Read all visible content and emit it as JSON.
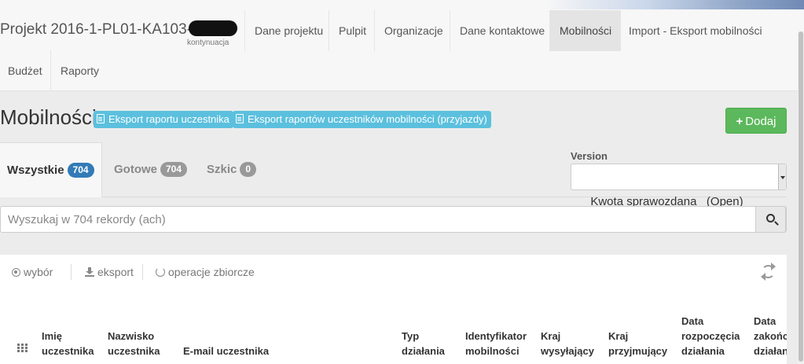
{
  "header": {
    "brand": "Projekt 2016-1-PL01-KA103-",
    "brand_sub": "kontynuacja",
    "nav": [
      {
        "label": "Dane projektu"
      },
      {
        "label": "Pulpit"
      },
      {
        "label": "Organizacje"
      },
      {
        "label": "Dane kontaktowe"
      },
      {
        "label": "Mobilności",
        "active": true
      },
      {
        "label": "Import - Eksport mobilności"
      },
      {
        "label": "Budżet"
      },
      {
        "label": "Raporty"
      }
    ]
  },
  "page": {
    "title": "Mobilności",
    "export_participant_report": "Eksport raportu uczestnika",
    "export_mobility_reports": "Eksport raportów uczestników mobilności (przyjazdy)",
    "add_button": "Dodaj"
  },
  "tabs": [
    {
      "label": "Wszystkie",
      "count": "704",
      "active": true
    },
    {
      "label": "Gotowe",
      "count": "704"
    },
    {
      "label": "Szkic",
      "count": "0"
    }
  ],
  "version": {
    "label": "Version",
    "selected": "Kwota sprawozdana   (Open)"
  },
  "search": {
    "placeholder": "Wyszukaj w 704 rekordy (ach)"
  },
  "toolbar": {
    "select": "wybór",
    "export": "eksport",
    "bulk": "operacje zbiorcze"
  },
  "table": {
    "columns": [
      [
        "Imię",
        "uczestnika"
      ],
      [
        "Nazwisko",
        "uczestnika"
      ],
      [
        "E-mail uczestnika"
      ],
      [
        "Typ",
        "działania"
      ],
      [
        "Identyfikator",
        "mobilności"
      ],
      [
        "Kraj",
        "wysyłający"
      ],
      [
        "Kraj",
        "przyjmujący"
      ],
      [
        "Data",
        "rozpoczęcia",
        "działania"
      ],
      [
        "Data",
        "zakończenia",
        "działania"
      ]
    ]
  },
  "colors": {
    "info": "#5bc0de",
    "success": "#5cb85c",
    "primary": "#337ab7"
  }
}
